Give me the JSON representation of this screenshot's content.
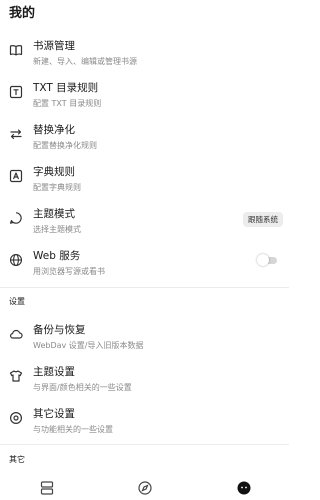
{
  "page_title": "我的",
  "items": [
    {
      "icon": "book-icon",
      "title": "书源管理",
      "subtitle": "新建、导入、编辑或管理书源"
    },
    {
      "icon": "txt-icon",
      "title": "TXT 目录规则",
      "subtitle": "配置 TXT 目录规则"
    },
    {
      "icon": "replace-icon",
      "title": "替换净化",
      "subtitle": "配置替换净化规则"
    },
    {
      "icon": "dictionary-icon",
      "title": "字典规则",
      "subtitle": "配置字典规则"
    },
    {
      "icon": "theme-mode-icon",
      "title": "主题模式",
      "subtitle": "选择主题模式",
      "chip": "跟随系统"
    },
    {
      "icon": "globe-icon",
      "title": "Web 服务",
      "subtitle": "用浏览器写源或看书",
      "toggle": false
    }
  ],
  "settings_header": "设置",
  "settings_items": [
    {
      "icon": "cloud-icon",
      "title": "备份与恢复",
      "subtitle": "WebDav 设置/导入旧版本数据"
    },
    {
      "icon": "shirt-icon",
      "title": "主题设置",
      "subtitle": "与界面/颜色相关的一些设置"
    },
    {
      "icon": "settings-icon",
      "title": "其它设置",
      "subtitle": "与功能相关的一些设置"
    }
  ],
  "other_header": "其它",
  "bottom_nav": [
    {
      "icon": "bookshelf-icon"
    },
    {
      "icon": "compass-icon"
    },
    {
      "icon": "profile-icon"
    }
  ]
}
